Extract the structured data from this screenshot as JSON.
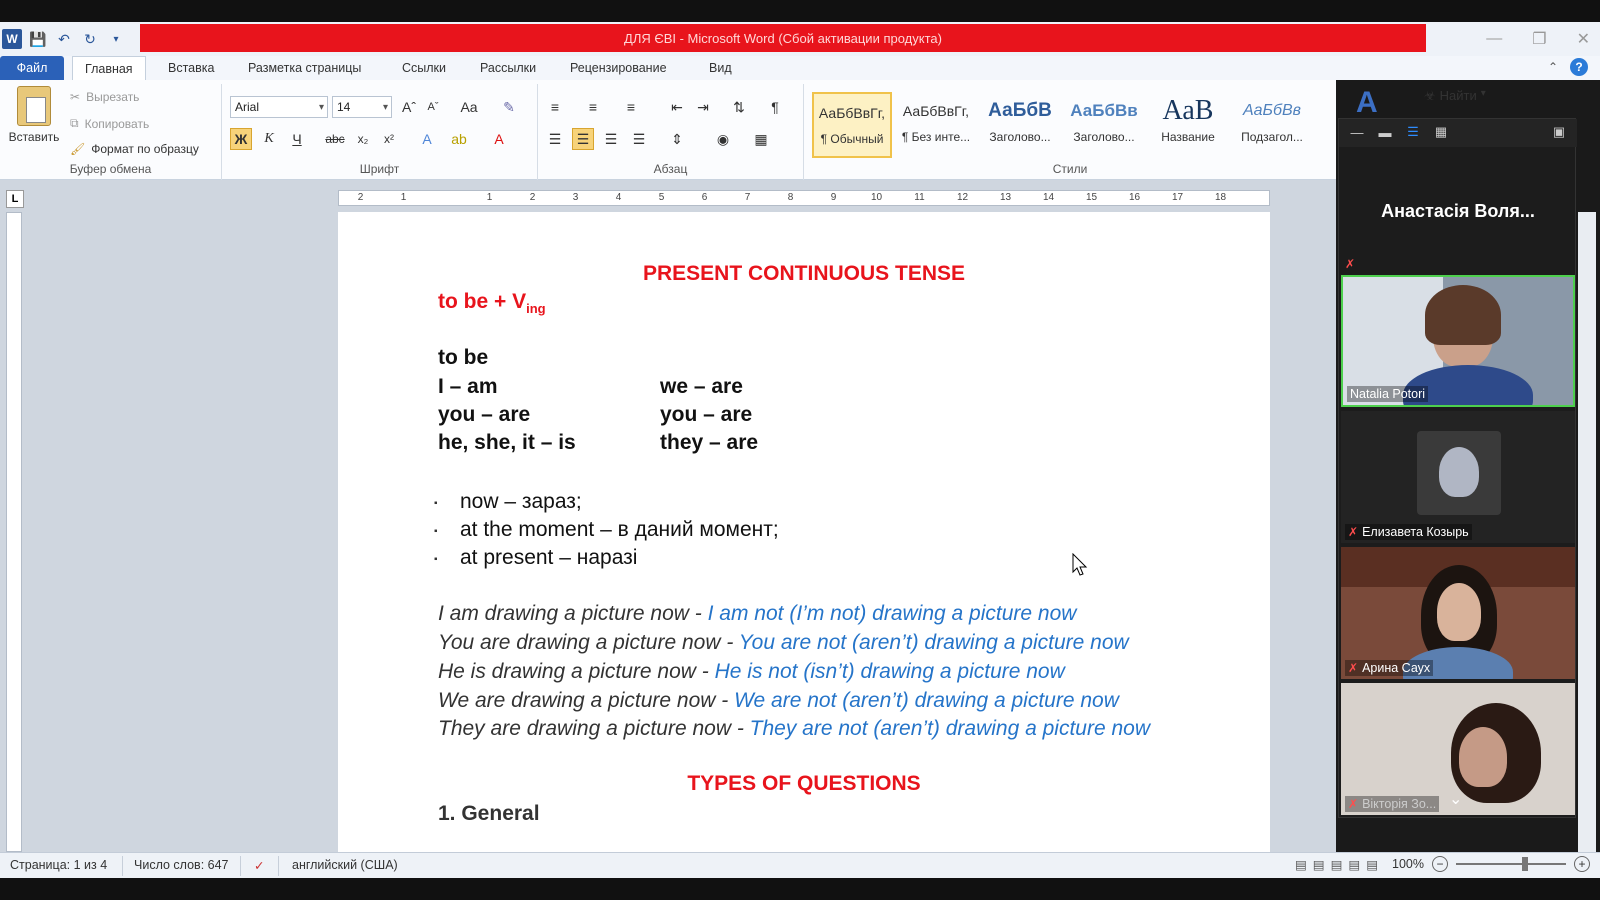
{
  "window": {
    "title": "ДЛЯ ЄВІ  -  Microsoft Word (Сбой активации продукта)"
  },
  "tabs": [
    "Файл",
    "Главная",
    "Вставка",
    "Разметка страницы",
    "Ссылки",
    "Рассылки",
    "Рецензирование",
    "Вид"
  ],
  "ribbon": {
    "clipboard": {
      "paste": "Вставить",
      "cut": "Вырезать",
      "copy": "Копировать",
      "format_painter": "Формат по образцу",
      "label": "Буфер обмена"
    },
    "font": {
      "name": "Arial",
      "size": "14",
      "label": "Шрифт",
      "bold": "Ж",
      "italic": "К",
      "underline": "Ч"
    },
    "paragraph": {
      "label": "Абзац"
    },
    "styles": {
      "label": "Стили",
      "items": [
        {
          "preview": "АаБбВвГг,",
          "name": "¶ Обычный"
        },
        {
          "preview": "АаБбВвГг,",
          "name": "¶ Без инте..."
        },
        {
          "preview": "АаБбВ",
          "name": "Заголово..."
        },
        {
          "preview": "АаБбВв",
          "name": "Заголово..."
        },
        {
          "preview": "АаВ",
          "name": "Название"
        },
        {
          "preview": "АаБбВв",
          "name": "Подзагол..."
        }
      ]
    },
    "find": "Найти"
  },
  "ruler_ticks": [
    "2",
    "1",
    "",
    "1",
    "2",
    "3",
    "4",
    "5",
    "6",
    "7",
    "8",
    "9",
    "10",
    "11",
    "12",
    "13",
    "14",
    "15",
    "16",
    "17",
    "18"
  ],
  "document": {
    "title": "PRESENT CONTINUOUS TENSE",
    "formula_main": "to be + V",
    "formula_sub": "ing",
    "tobe_heading": "to be",
    "conjugation": [
      {
        "left": "I – am",
        "right": "we – are"
      },
      {
        "left": "you – are",
        "right": "you – are"
      },
      {
        "left": "he, she, it –  is",
        "right": "they – are"
      }
    ],
    "bullets": [
      "now – зараз;",
      "at the moment – в даний момент;",
      "at present – наразі"
    ],
    "examples": [
      {
        "pos": "I am drawing a picture now - ",
        "neg": "I am not (I’m  not) drawing a picture now"
      },
      {
        "pos": "You are drawing a picture now - ",
        "neg": "You are not (aren’t) drawing a picture now"
      },
      {
        "pos": "He is drawing a picture now - ",
        "neg": "He is not (isn’t) drawing a picture now"
      },
      {
        "pos": "We are drawing a picture now - ",
        "neg": "We are not (aren’t) drawing a picture now"
      },
      {
        "pos": "They are drawing a picture now - ",
        "neg": "They are not (aren’t) drawing a picture now"
      }
    ],
    "questions_heading": "TYPES OF QUESTIONS",
    "item_general": "1. General"
  },
  "statusbar": {
    "page": "Страница: 1 из 4",
    "words": "Число слов: 647",
    "language": "английский (США)",
    "zoom": "100%"
  },
  "zoom_panel": {
    "speaker": "Анастасія Воля...",
    "participants": [
      "Natalia Potori",
      "Елизавета Козырь",
      "Арина Саух",
      "Вікторія Зо..."
    ]
  },
  "colors": {
    "title_red": "#e8141c",
    "accent_blue": "#2b61b8",
    "example_blue": "#2574c9"
  }
}
